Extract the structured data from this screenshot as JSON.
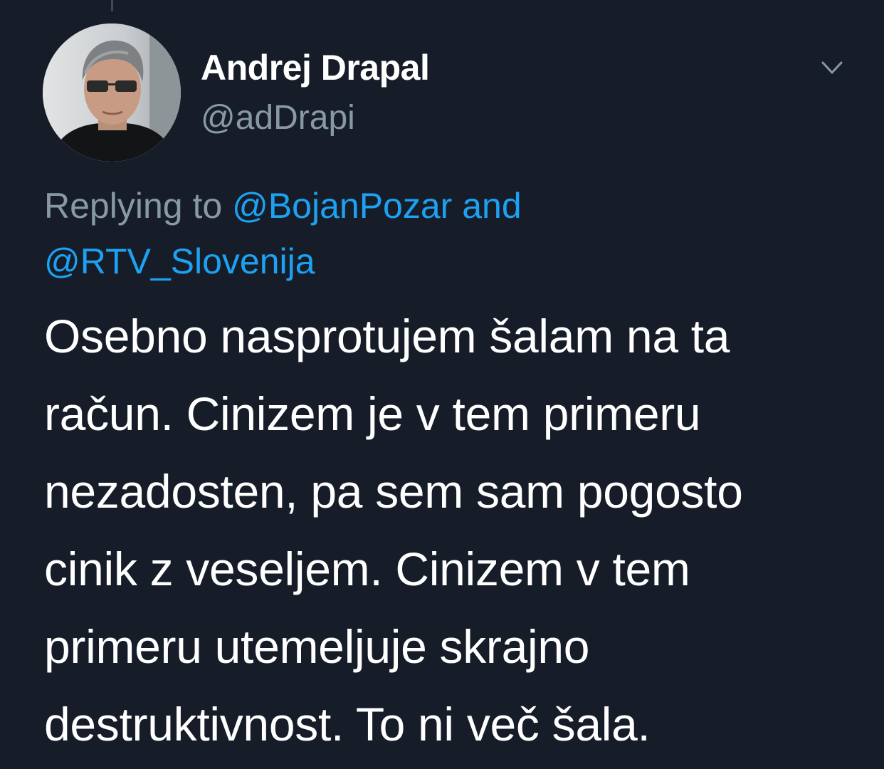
{
  "author": {
    "name": "Andrej Drapal",
    "handle": "@adDrapi"
  },
  "icons": {
    "menu": "chevron-down-icon",
    "avatar": "profile-photo"
  },
  "reply": {
    "prefix": "Replying to",
    "mention_1": "@BojanPozar",
    "conjunction": "and",
    "mention_2": "@RTV_Slovenija"
  },
  "tweet": {
    "lines": [
      "Osebno nasprotujem šalam na ta",
      "račun. Cinizem je v tem primeru",
      "nezadosten, pa sem sam pogosto",
      "cinik z veseljem. Cinizem v tem",
      "primeru utemeljuje skrajno",
      "destruktivnost. To ni več šala."
    ]
  },
  "colors": {
    "background": "#161d28",
    "primary_text": "#ffffff",
    "secondary_text": "#8899a6",
    "accent": "#1da1f2"
  }
}
